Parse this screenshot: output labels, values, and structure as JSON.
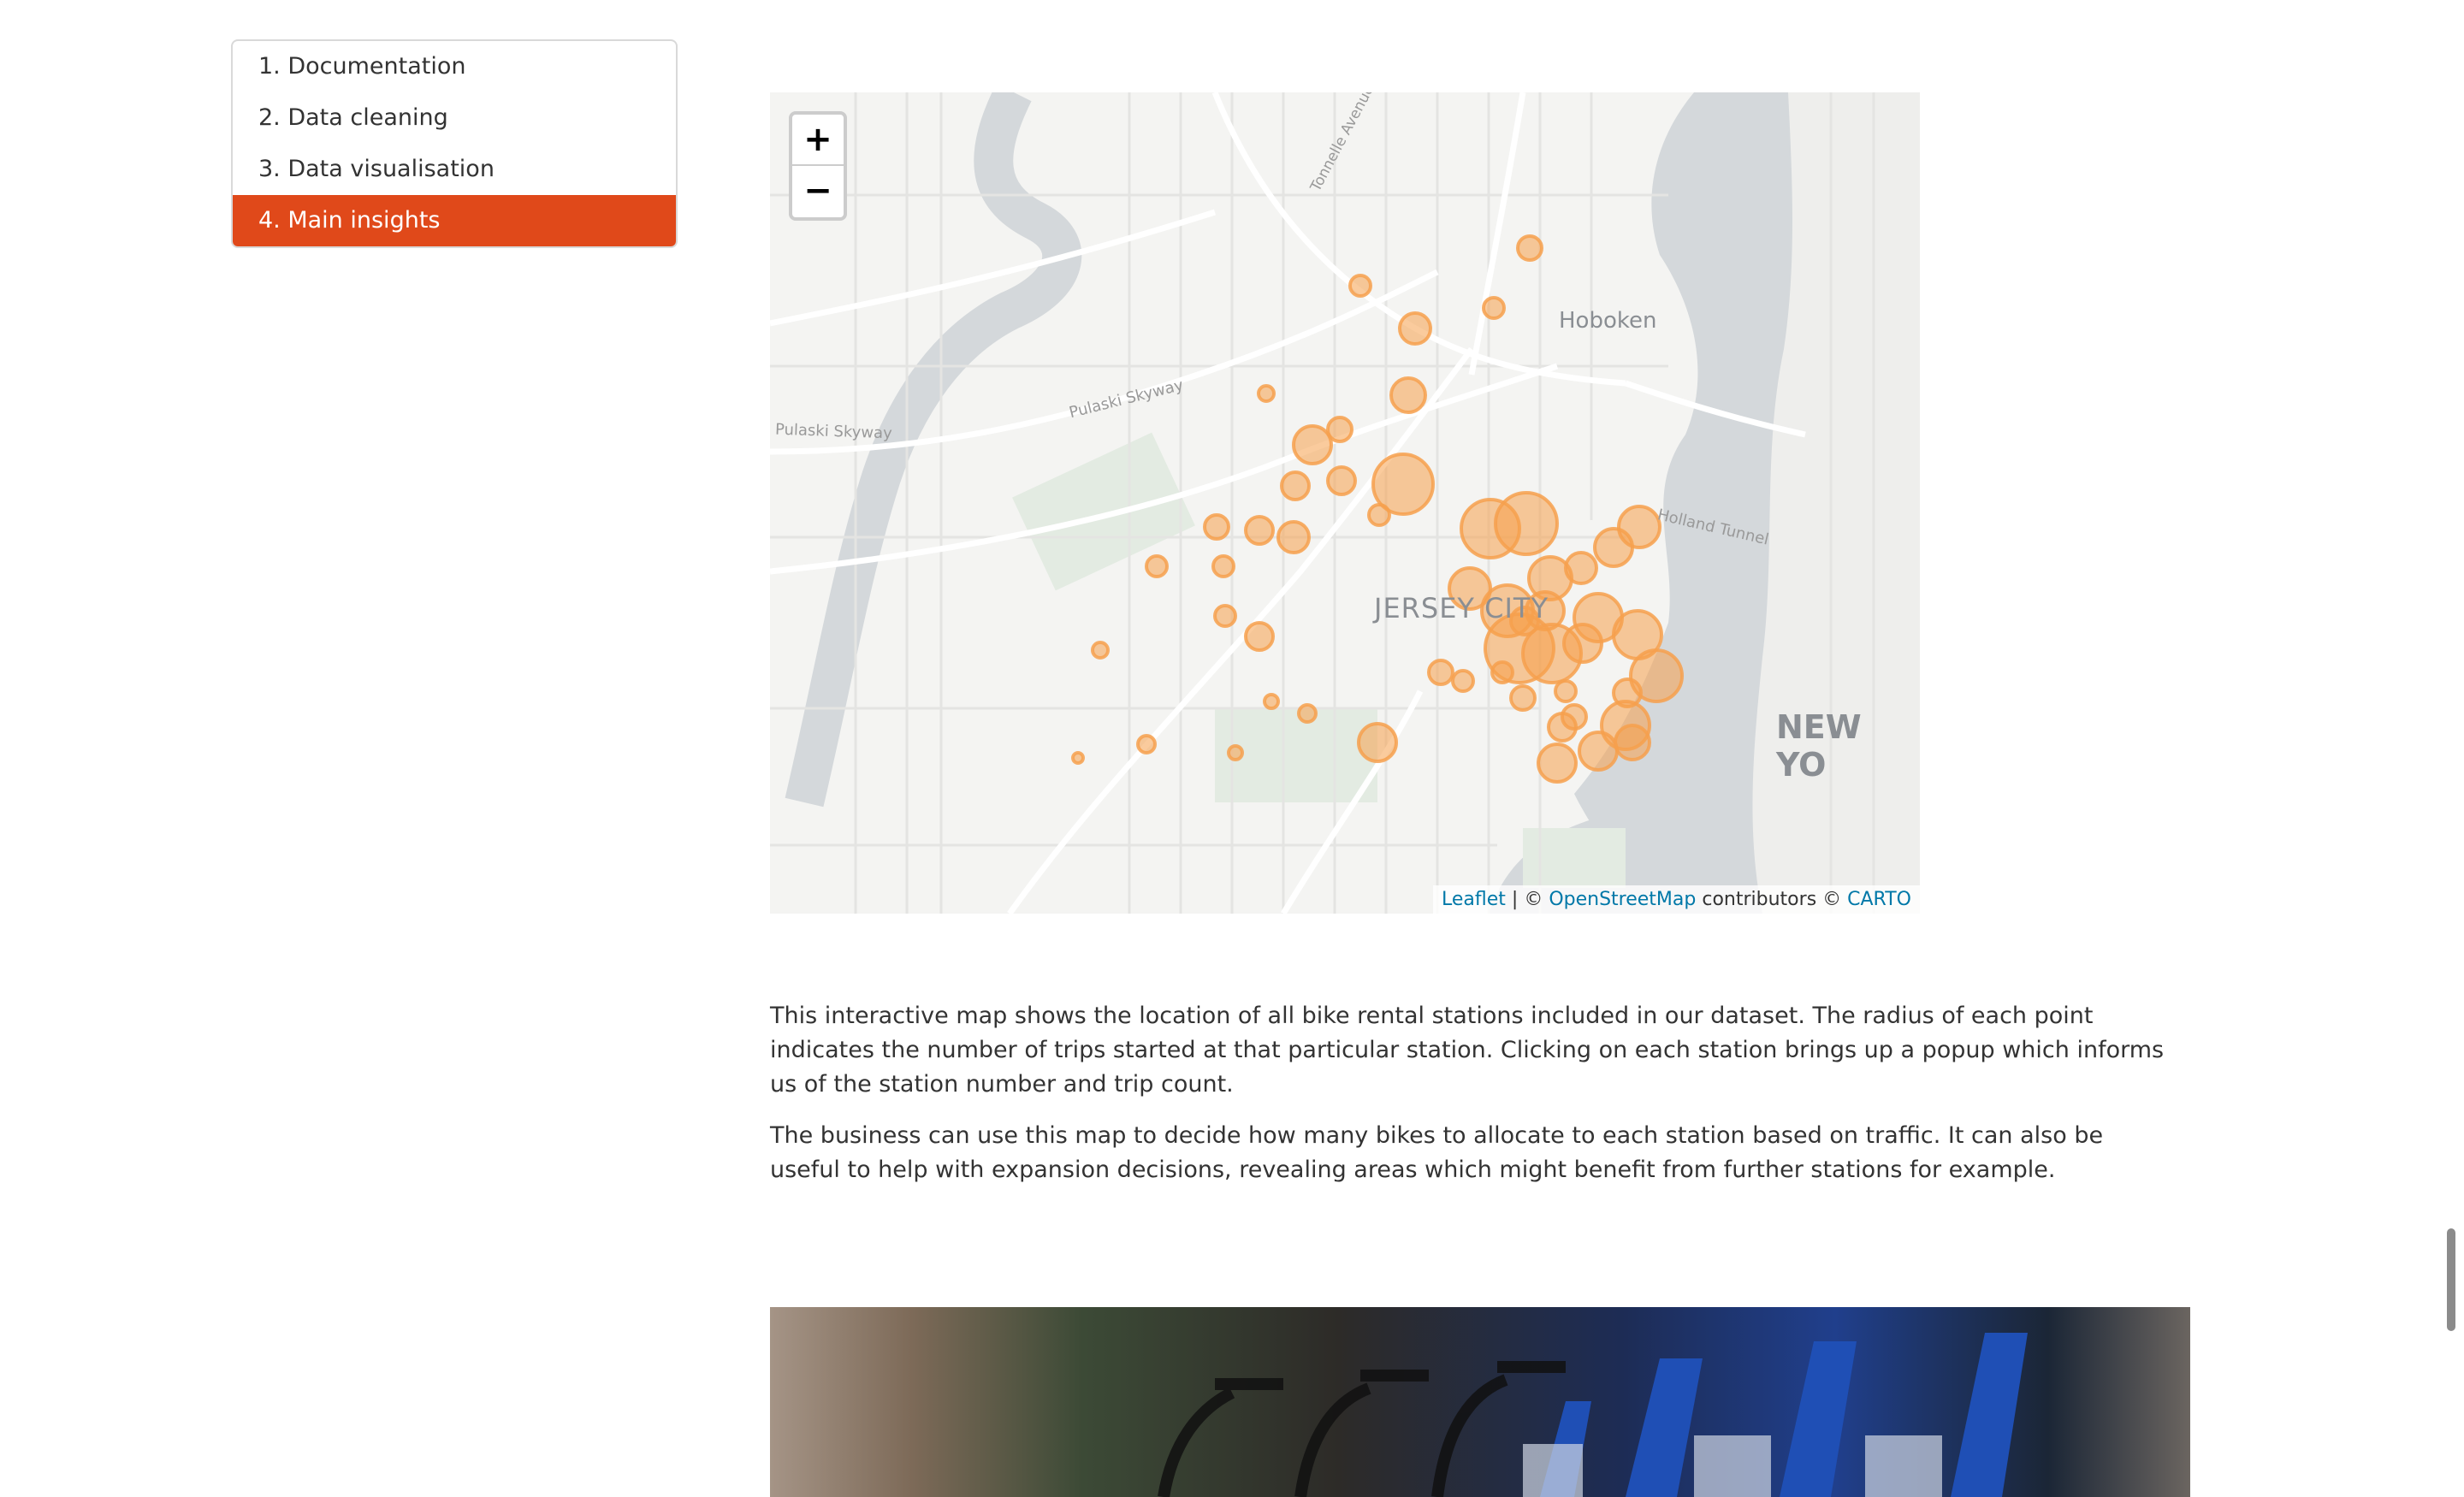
{
  "toc": {
    "items": [
      {
        "label": "1. Documentation",
        "active": false
      },
      {
        "label": "2. Data cleaning",
        "active": false
      },
      {
        "label": "3. Data visualisation",
        "active": false
      },
      {
        "label": "4. Main insights",
        "active": true
      }
    ]
  },
  "map": {
    "zoom_in": "+",
    "zoom_out": "−",
    "labels": {
      "hoboken": "Hoboken",
      "jersey_city": "JERSEY CITY",
      "new_york": "NEW YO",
      "pulaski1": "Pulaski Skyway",
      "pulaski2": "Pulaski Skyway",
      "holland": "Holland Tunnel",
      "tonnelle": "Tonnelle Avenue"
    },
    "attribution": {
      "leaflet": "Leaflet",
      "sep": " | © ",
      "osm": "OpenStreetMap",
      "contrib": " contributors © ",
      "carto": "CARTO"
    },
    "marker_color": "#f6a04d"
  },
  "content": {
    "para1": "This interactive map shows the location of all bike rental stations included in our dataset. The radius of each point indicates the number of trips started at that particular station. Clicking on each station brings up a popup which informs us of the station number and trip count.",
    "para2": "The business can use this map to decide how many bikes to allocate to each station based on traffic. It can also be useful to help with expansion decisions, revealing areas which might benefit from further stations for example."
  },
  "colors": {
    "accent": "#e0491a",
    "link": "#0078a8"
  }
}
